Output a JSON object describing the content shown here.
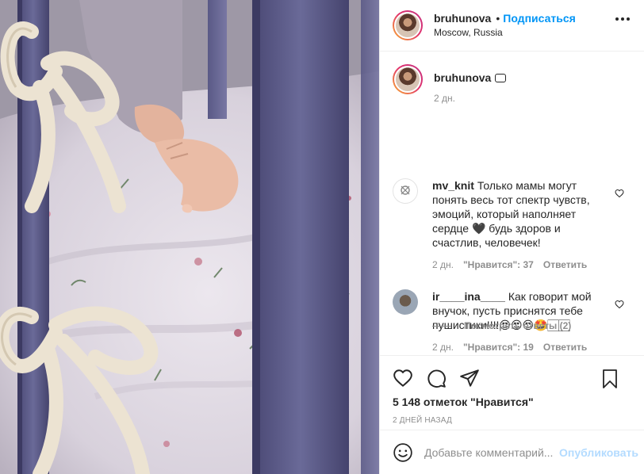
{
  "post": {
    "username": "bruhunova",
    "follow_label": "Подписаться",
    "separator": "•",
    "location": "Moscow, Russia"
  },
  "caption": {
    "username": "bruhunova",
    "time": "2 дн."
  },
  "comments": [
    {
      "username": "mv_knit",
      "text": "Только мамы могут понять весь тот спектр чувств, эмоций, который наполняет сердце 🖤 будь здоров и счастлив, человечек!",
      "time": "2 дн.",
      "likes": "\"Нравится\": 37",
      "reply": "Ответить"
    },
    {
      "username": "ir____ina____",
      "text": "Как говорит мой внучок, пусть приснятся тебе пушистики!!!!😍😍😍🤩🏻🏻",
      "time": "2 дн.",
      "likes": "\"Нравится\": 19",
      "reply": "Ответить"
    }
  ],
  "view_replies": "Посмотреть ответы (2)",
  "likes_text": "5 148 отметок \"Нравится\"",
  "date_text": "2 дней назад",
  "add_comment": {
    "placeholder": "Добавьте комментарий...",
    "post_label": "Опубликовать"
  },
  "colors": {
    "accent": "#0095f6",
    "post_disabled": "#b3dbff",
    "muted": "#8e8e8e",
    "text": "#262626",
    "crib_bar": "#5b5a86"
  },
  "icons": [
    "more-icon",
    "heart-icon",
    "comment-icon",
    "share-icon",
    "bookmark-icon",
    "emoji-icon"
  ]
}
